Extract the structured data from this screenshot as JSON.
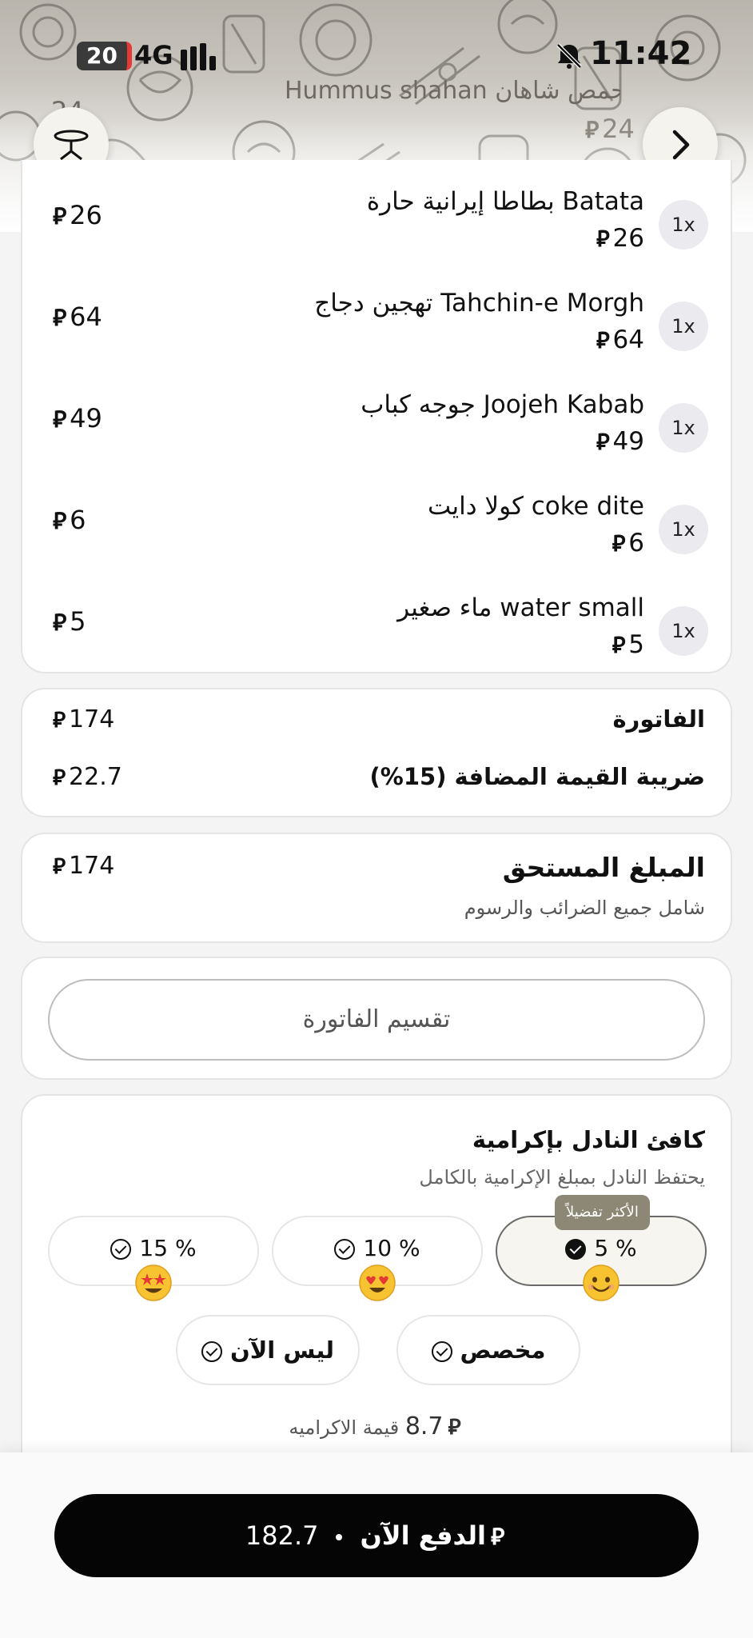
{
  "status_bar": {
    "battery": "20",
    "network": "4G",
    "time": "11:42"
  },
  "header": {
    "restaurant_name": "Hummus shahan حمص شاهان",
    "ghost_left": "24",
    "ghost_price": "24"
  },
  "currency_symbol": "⃁",
  "items": [
    {
      "qty": "1x",
      "name": "بطاطا إيرانية حارة Batata",
      "unit_price": "26",
      "total": "26"
    },
    {
      "qty": "1x",
      "name": "تهجين دجاج Tahchin-e Morgh",
      "unit_price": "64",
      "total": "64"
    },
    {
      "qty": "1x",
      "name": "جوجه كباب Joojeh Kabab",
      "unit_price": "49",
      "total": "49"
    },
    {
      "qty": "1x",
      "name": "كولا دايت coke dite",
      "unit_price": "6",
      "total": "6"
    },
    {
      "qty": "1x",
      "name": "ماء صغير water small",
      "unit_price": "5",
      "total": "5"
    }
  ],
  "invoice": {
    "invoice_label": "الفاتورة",
    "invoice_value": "174",
    "vat_label": "ضريبة القيمة المضافة (15%)",
    "vat_value": "22.7"
  },
  "amount_due": {
    "title": "المبلغ المستحق",
    "subtitle": "شامل جميع الضرائب والرسوم",
    "value": "174"
  },
  "split": {
    "label": "تقسيم الفاتورة"
  },
  "tip": {
    "title": "كافئ النادل بإكرامية",
    "subtitle": "يحتفظ النادل بمبلغ الإكرامية بالكامل",
    "popular_badge": "الأكثر تفضيلاً",
    "options": [
      {
        "label": "5 %",
        "selected": true
      },
      {
        "label": "10 %",
        "selected": false
      },
      {
        "label": "15 %",
        "selected": false
      }
    ],
    "custom_label": "مخصص",
    "not_now_label": "ليس الآن",
    "amount_label": "قيمة الاكراميه",
    "amount_value": "8.7"
  },
  "pay": {
    "label": "الدفع الآن",
    "amount": "182.7"
  }
}
